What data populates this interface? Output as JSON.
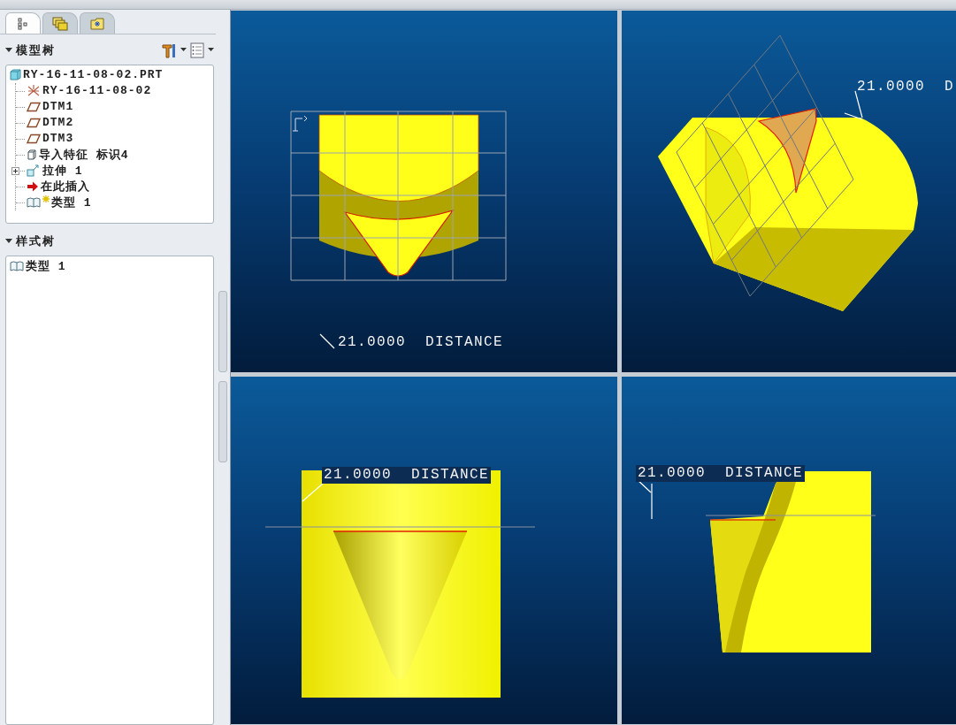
{
  "panel_tabs": [
    {
      "kind": "tree",
      "selected": true
    },
    {
      "kind": "layers",
      "selected": false
    },
    {
      "kind": "folder",
      "selected": false
    }
  ],
  "model_tree": {
    "title": "模型树",
    "items": [
      {
        "label": "RY-16-11-08-02.PRT",
        "kind": "part",
        "children": [
          {
            "label": "RY-16-11-08-02",
            "kind": "csys"
          },
          {
            "label": "DTM1",
            "kind": "plane"
          },
          {
            "label": "DTM2",
            "kind": "plane"
          },
          {
            "label": "DTM3",
            "kind": "plane"
          },
          {
            "label": "导入特征 标识4",
            "kind": "import"
          },
          {
            "label": "拉伸 1",
            "kind": "extrude",
            "expanded": false
          },
          {
            "label": "在此插入",
            "kind": "insert"
          },
          {
            "label": "类型 1",
            "kind": "style",
            "marked": true
          }
        ]
      }
    ]
  },
  "style_tree": {
    "title": "样式树",
    "items": [
      {
        "label": "类型 1",
        "kind": "style",
        "marked": false
      }
    ]
  },
  "viewports": [
    {
      "kind": "front",
      "dimension": "21.0000  DISTANCE"
    },
    {
      "kind": "iso",
      "dimension": "21.0000  D"
    },
    {
      "kind": "top",
      "dimension": "21.0000  DISTANCE"
    },
    {
      "kind": "side",
      "dimension": "21.0000  DISTANCE"
    }
  ]
}
